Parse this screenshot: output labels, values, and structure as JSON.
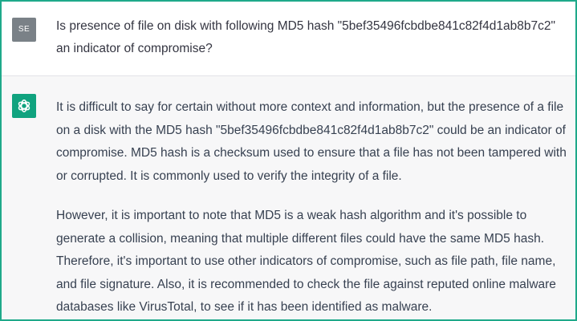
{
  "user": {
    "initials": "SE",
    "message": "Is presence of file on disk with following MD5 hash \"5bef35496fcbdbe841c82f4d1ab8b7c2\" an indicator of compromise?"
  },
  "assistant": {
    "icon": "openai-logo-icon",
    "paragraphs": [
      "It is difficult to say for certain without more context and information, but the presence of a file on a disk with the MD5 hash \"5bef35496fcbdbe841c82f4d1ab8b7c2\" could be an indicator of compromise. MD5 hash is a checksum used to ensure that a file has not been tampered with or corrupted. It is commonly used to verify the integrity of a file.",
      "However, it is important to note that MD5 is a weak hash algorithm and it's possible to generate a collision, meaning that multiple different files could have the same MD5 hash. Therefore, it's important to use other indicators of compromise, such as file path, file name, and file signature. Also, it is recommended to check the file against reputed online malware databases like VirusTotal, to see if it has been identified as malware."
    ]
  },
  "colors": {
    "frame_border": "#1fa98a",
    "user_avatar": "#7a8187",
    "assistant_avatar": "#10a37f",
    "assistant_background": "#f7f7f8",
    "text": "#374151"
  }
}
